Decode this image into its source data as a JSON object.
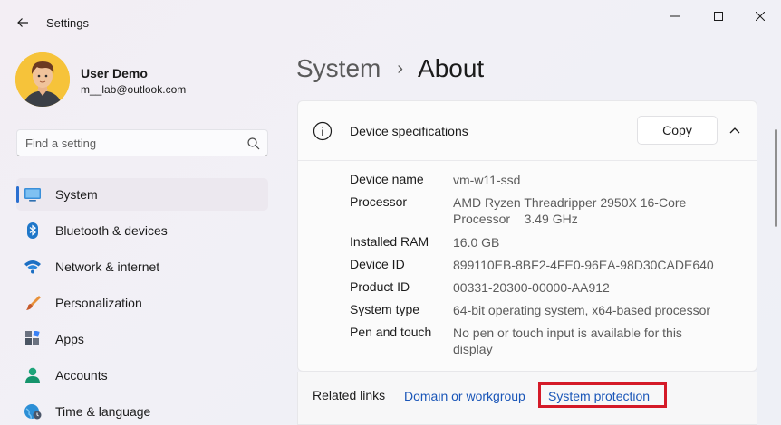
{
  "window": {
    "title": "Settings",
    "controls": [
      "minimize",
      "maximize",
      "close"
    ]
  },
  "user": {
    "name": "User Demo",
    "email": "m__lab@outlook.com"
  },
  "search": {
    "placeholder": "Find a setting",
    "value": ""
  },
  "sidebar": {
    "items": [
      {
        "label": "System",
        "icon": "monitor-icon",
        "active": true
      },
      {
        "label": "Bluetooth & devices",
        "icon": "bluetooth-icon",
        "active": false
      },
      {
        "label": "Network & internet",
        "icon": "wifi-icon",
        "active": false
      },
      {
        "label": "Personalization",
        "icon": "brush-icon",
        "active": false
      },
      {
        "label": "Apps",
        "icon": "apps-icon",
        "active": false
      },
      {
        "label": "Accounts",
        "icon": "person-icon",
        "active": false
      },
      {
        "label": "Time & language",
        "icon": "globe-icon",
        "active": false
      }
    ]
  },
  "breadcrumb": {
    "parent": "System",
    "separator": "›",
    "current": "About"
  },
  "device_specs": {
    "title": "Device specifications",
    "copy_label": "Copy",
    "expanded": true,
    "rows": [
      {
        "label": "Device name",
        "value": "vm-w11-ssd"
      },
      {
        "label": "Processor",
        "value": "AMD Ryzen Threadripper 2950X 16-Core Processor    3.49 GHz"
      },
      {
        "label": "Installed RAM",
        "value": "16.0 GB"
      },
      {
        "label": "Device ID",
        "value": "899110EB-8BF2-4FE0-96EA-98D30CADE640"
      },
      {
        "label": "Product ID",
        "value": "00331-20300-00000-AA912"
      },
      {
        "label": "System type",
        "value": "64-bit operating system, x64-based processor"
      },
      {
        "label": "Pen and touch",
        "value": "No pen or touch input is available for this display"
      }
    ]
  },
  "related_links": {
    "label": "Related links",
    "links": [
      "Domain or workgroup",
      "System protection"
    ],
    "highlighted": "System protection",
    "highlight_color": "#d41a28"
  },
  "colors": {
    "accent": "#2a6fd0",
    "link": "#1a56b8"
  }
}
